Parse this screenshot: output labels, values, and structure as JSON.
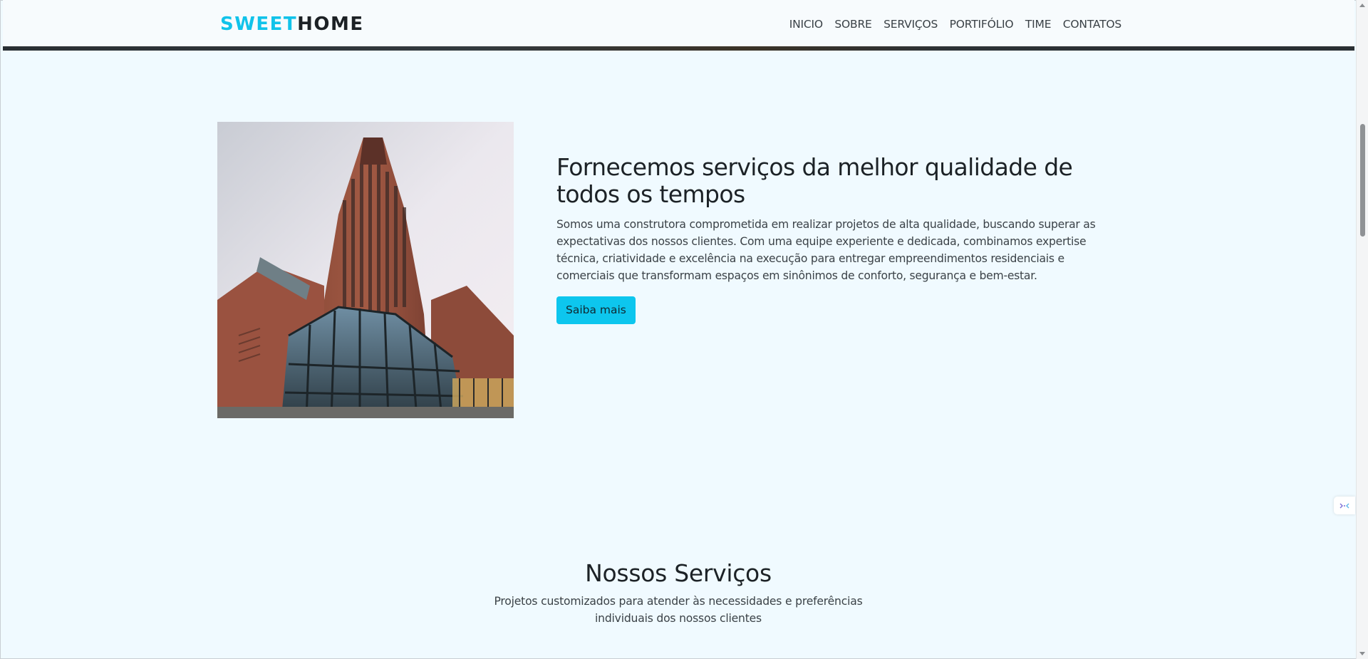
{
  "brand": {
    "part_a": "SWEET",
    "part_b": "HOME",
    "accent_color": "#11c3ea",
    "dark_color": "#1c2125"
  },
  "nav": {
    "items": [
      {
        "label": "INICIO"
      },
      {
        "label": "SOBRE"
      },
      {
        "label": "SERVIÇOS"
      },
      {
        "label": "PORTIFÓLIO"
      },
      {
        "label": "TIME"
      },
      {
        "label": "CONTATOS"
      }
    ]
  },
  "about": {
    "image_icon": "building-photo",
    "title_line1": "Fornecemos serviços da melhor qualidade de",
    "title_line2": "todos os tempos",
    "paragraph_line1": "Somos uma construtora comprometida em realizar projetos de alta qualidade, buscando superar as",
    "paragraph_line2": "expectativas dos nossos clientes. Com uma equipe experiente e dedicada, combinamos expertise",
    "paragraph_line3": "técnica, criatividade e excelência na execução para entregar empreendimentos residenciais e",
    "paragraph_line4": "comerciais que transformam espaços em sinônimos de conforto, segurança e bem-estar.",
    "button_label": "Saiba mais",
    "button_color": "#0dc6ee"
  },
  "services": {
    "title": "Nossos Serviços",
    "subtitle_line1": "Projetos customizados para atender às necessidades e preferências",
    "subtitle_line2": "individuais dos nossos clientes"
  },
  "page": {
    "background_color": "#f0faff",
    "side_widget_icon": "assistant-icon"
  }
}
